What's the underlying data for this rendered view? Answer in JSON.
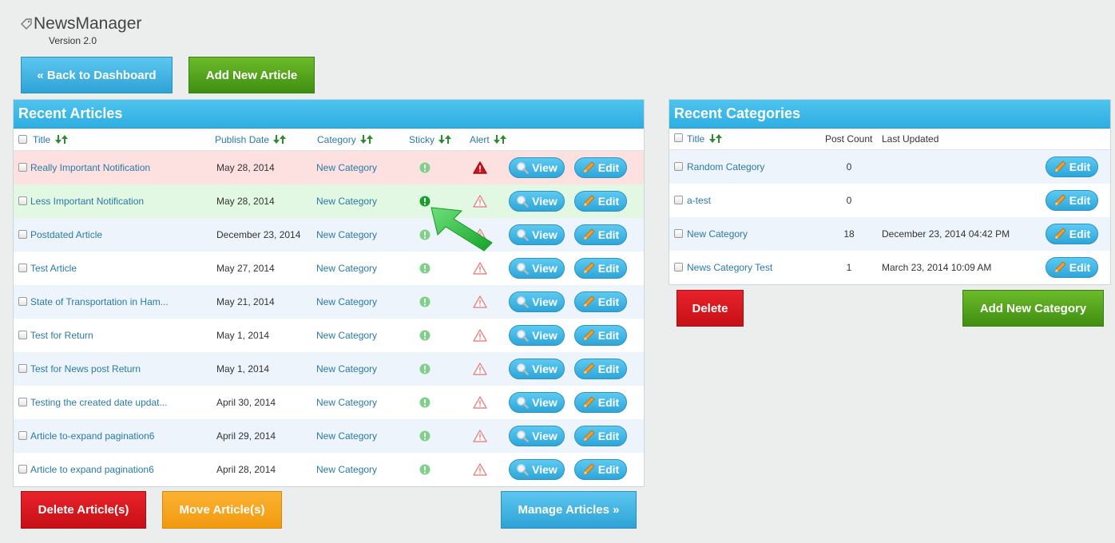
{
  "app": {
    "title": "NewsManager",
    "version": "Version 2.0"
  },
  "toolbar": {
    "back_label": "« Back to Dashboard",
    "add_article_label": "Add New Article"
  },
  "articles": {
    "title": "Recent Articles",
    "columns": {
      "title": "Title",
      "publish_date": "Publish Date",
      "category": "Category",
      "sticky": "Sticky",
      "alert": "Alert"
    },
    "view_label": "View",
    "edit_label": "Edit",
    "rows": [
      {
        "title": "Really Important Notification",
        "date": "May 28, 2014",
        "category": "New Category"
      },
      {
        "title": "Less Important Notification",
        "date": "May 28, 2014",
        "category": "New Category"
      },
      {
        "title": "Postdated Article",
        "date": "December 23, 2014",
        "category": "New Category"
      },
      {
        "title": "Test Article",
        "date": "May 27, 2014",
        "category": "New Category"
      },
      {
        "title": "State of Transportation in Ham...",
        "date": "May 21, 2014",
        "category": "New Category"
      },
      {
        "title": "Test for Return",
        "date": "May 1, 2014",
        "category": "New Category"
      },
      {
        "title": "Test for News post Return",
        "date": "May 1, 2014",
        "category": "New Category"
      },
      {
        "title": "Testing the created date updat...",
        "date": "April 30, 2014",
        "category": "New Category"
      },
      {
        "title": "Article to-expand pagination6",
        "date": "April 29, 2014",
        "category": "New Category"
      },
      {
        "title": "Article to expand pagination6",
        "date": "April 28, 2014",
        "category": "New Category"
      }
    ],
    "delete_label": "Delete Article(s)",
    "move_label": "Move Article(s)",
    "manage_label": "Manage Articles »"
  },
  "categories": {
    "title": "Recent Categories",
    "columns": {
      "title": "Title",
      "post_count": "Post Count",
      "last_updated": "Last Updated"
    },
    "edit_label": "Edit",
    "rows": [
      {
        "title": "Random Category",
        "count": "0",
        "updated": ""
      },
      {
        "title": "a-test",
        "count": "0",
        "updated": ""
      },
      {
        "title": "New Category",
        "count": "18",
        "updated": "December 23, 2014 04:42 PM"
      },
      {
        "title": "News Category Test",
        "count": "1",
        "updated": "March 23, 2014 10:09 AM"
      }
    ],
    "delete_label": "Delete",
    "add_label": "Add New Category"
  },
  "colors": {
    "accent": "#2eaee2",
    "green": "#3f8f12",
    "red": "#d0161d",
    "orange": "#f5a21e"
  }
}
